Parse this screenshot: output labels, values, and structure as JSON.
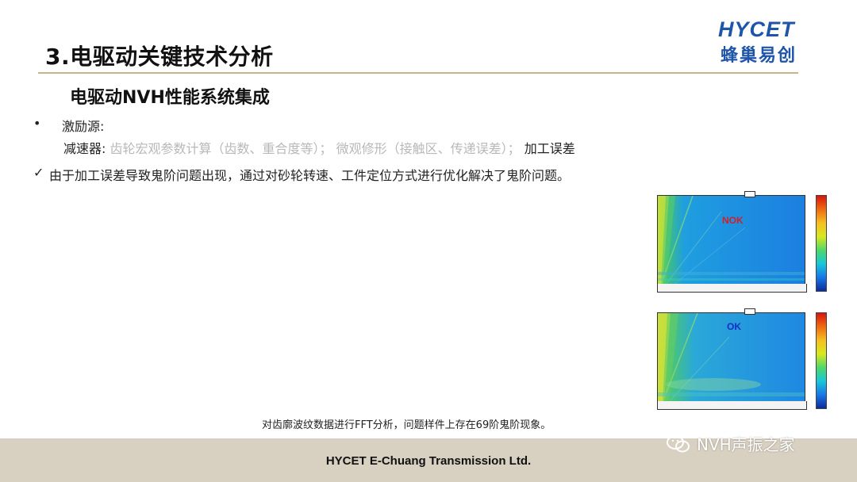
{
  "header": {
    "title": "3.电驱动关键技术分析",
    "subtitle": "电驱动NVH性能系统集成"
  },
  "logo": {
    "name_en": "HYCET",
    "name_cn": "蜂巢易创"
  },
  "content": {
    "bullet_label": "激励源:",
    "reducer_label": "减速器:",
    "reducer_gray_items": "齿轮宏观参数计算（齿数、重合度等）；  微观修形（接触区、传递误差）；",
    "reducer_highlight": "加工误差",
    "conclusion": "由于加工误差导致鬼阶问题出现，通过对砂轮转速、工件定位方式进行优化解决了鬼阶问题。",
    "caption": "对齿廓波纹数据进行FFT分析，问题样件上存在69阶鬼阶现象。"
  },
  "plots": [
    {
      "label": "NOK",
      "label_color": "#d0202a"
    },
    {
      "label": "OK",
      "label_color": "#1530c0"
    }
  ],
  "footer": {
    "company": "HYCET E-Chuang Transmission Ltd."
  },
  "watermark": {
    "icon": "wechat-icon",
    "text": "NVH声振之家"
  },
  "colors": {
    "accent_rule": "#c9b48a",
    "footer_bg": "#d8d0c1",
    "logo_blue": "#1e55a8",
    "muted_text": "#b8b8b8"
  }
}
